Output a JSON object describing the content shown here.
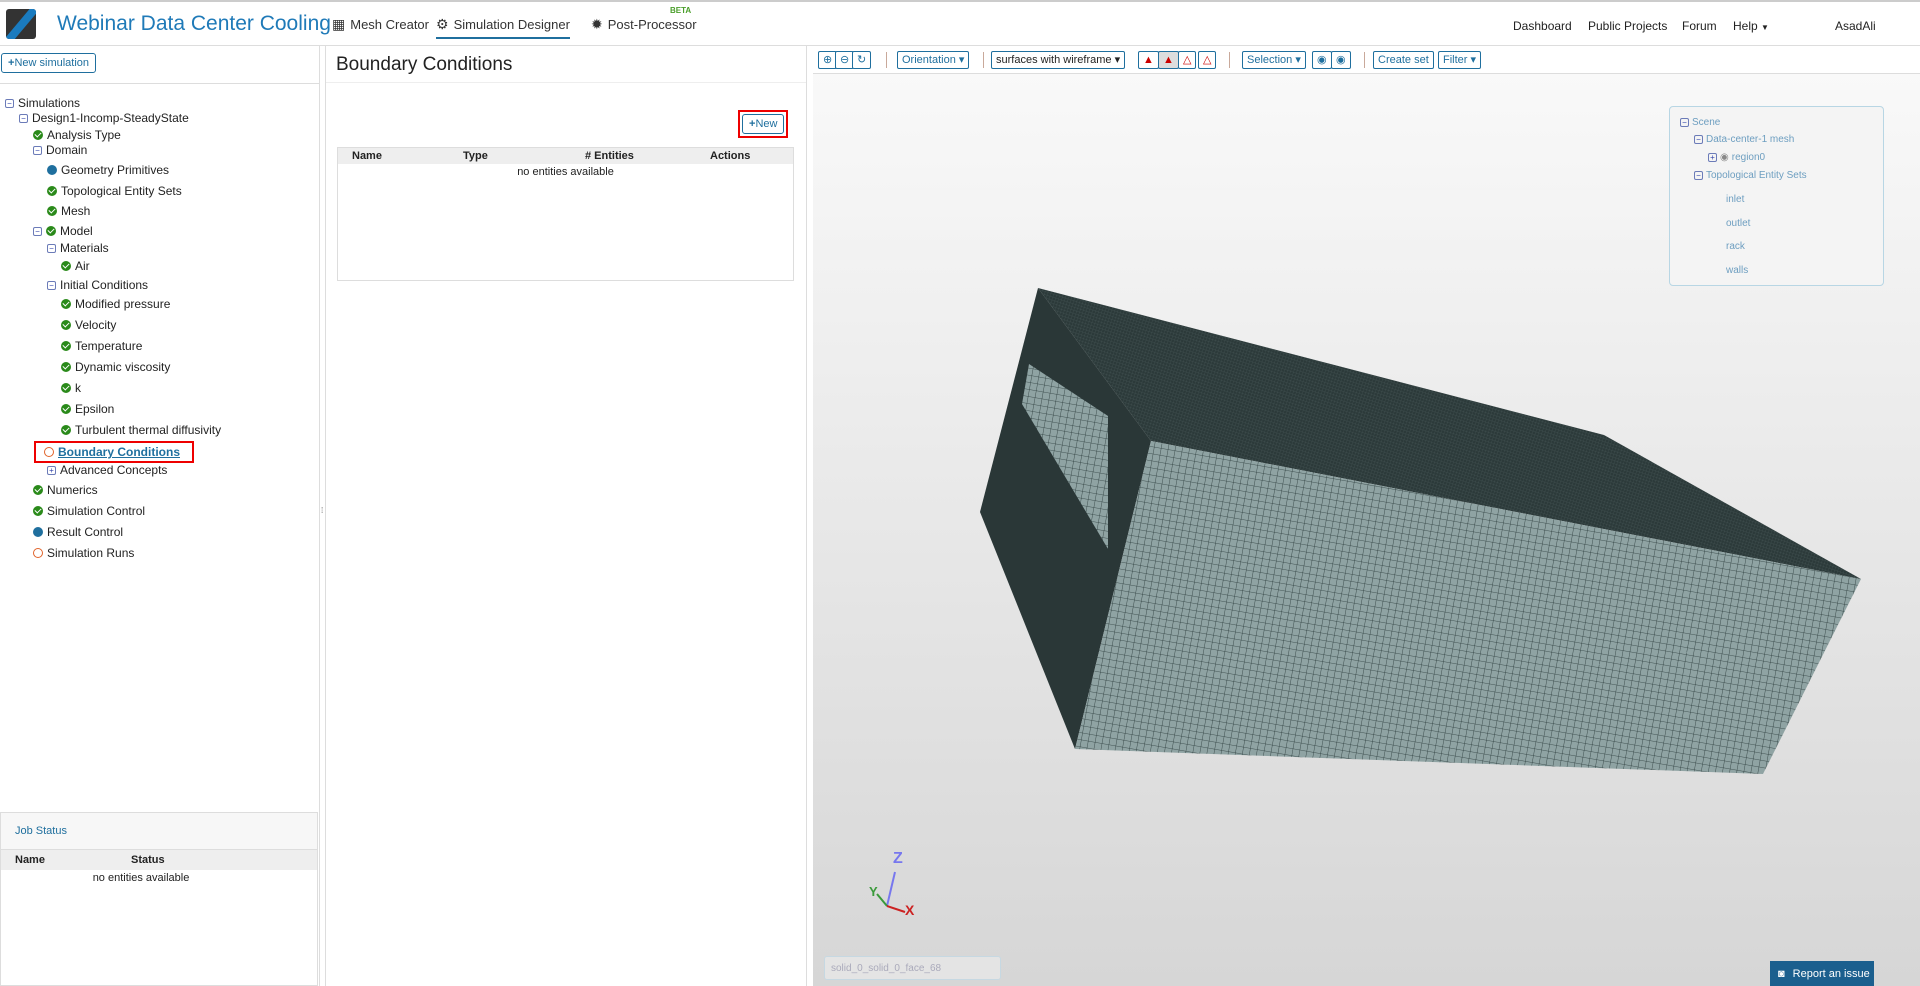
{
  "header": {
    "title": "Webinar Data Center Cooling",
    "nav": [
      "Mesh Creator",
      "Simulation Designer",
      "Post-Processor"
    ],
    "beta": "BETA",
    "right": [
      "Dashboard",
      "Public Projects",
      "Forum",
      "Help",
      "AsadAli"
    ]
  },
  "left": {
    "new_simulation": "New simulation",
    "tree": [
      {
        "label": "Simulations",
        "icon": "minus",
        "level": 0
      },
      {
        "label": "Design1-Incomp-SteadyState",
        "icon": "minus",
        "level": 1
      },
      {
        "label": "Analysis Type",
        "icon": "ok",
        "level": 2
      },
      {
        "label": "Domain",
        "icon": "minus",
        "level": 2
      },
      {
        "label": "Geometry Primitives",
        "icon": "dot",
        "level": 3
      },
      {
        "label": "Topological Entity Sets",
        "icon": "ok",
        "level": 3
      },
      {
        "label": "Mesh",
        "icon": "ok",
        "level": 3
      },
      {
        "label": "Model",
        "icon": "minus-ok",
        "level": 2
      },
      {
        "label": "Materials",
        "icon": "minus",
        "level": 3
      },
      {
        "label": "Air",
        "icon": "ok",
        "level": 4
      },
      {
        "label": "Initial Conditions",
        "icon": "minus",
        "level": 3
      },
      {
        "label": "Modified pressure",
        "icon": "ok",
        "level": 4
      },
      {
        "label": "Velocity",
        "icon": "ok",
        "level": 4
      },
      {
        "label": "Temperature",
        "icon": "ok",
        "level": 4
      },
      {
        "label": "Dynamic viscosity",
        "icon": "ok",
        "level": 4
      },
      {
        "label": "k",
        "icon": "ok",
        "level": 4
      },
      {
        "label": "Epsilon",
        "icon": "ok",
        "level": 4
      },
      {
        "label": "Turbulent thermal diffusivity",
        "icon": "ok",
        "level": 4
      },
      {
        "label": "Boundary Conditions",
        "icon": "ring",
        "level": 3,
        "selected": true
      },
      {
        "label": "Advanced Concepts",
        "icon": "plus",
        "level": 3
      },
      {
        "label": "Numerics",
        "icon": "ok",
        "level": 2
      },
      {
        "label": "Simulation Control",
        "icon": "ok",
        "level": 2
      },
      {
        "label": "Result Control",
        "icon": "dot",
        "level": 2
      },
      {
        "label": "Simulation Runs",
        "icon": "ring",
        "level": 2
      }
    ],
    "job_status": {
      "title": "Job Status",
      "columns": [
        "Name",
        "Status"
      ],
      "empty": "no entities available"
    }
  },
  "middle": {
    "title": "Boundary Conditions",
    "new": "New",
    "columns": [
      "Name",
      "Type",
      "# Entities",
      "Actions"
    ],
    "empty": "no entities available"
  },
  "viewer": {
    "toolbar": {
      "orientation": "Orientation",
      "render_mode": "surfaces with wireframe",
      "selection": "Selection",
      "create_set": "Create set",
      "filter": "Filter"
    },
    "scene": {
      "root": "Scene",
      "mesh": "Data-center-1 mesh",
      "region": "region0",
      "sets_label": "Topological Entity Sets",
      "sets": [
        "inlet",
        "outlet",
        "rack",
        "walls"
      ]
    },
    "axes": {
      "x": "X",
      "y": "Y",
      "z": "Z"
    },
    "selection_field": "solid_0_solid_0_face_68",
    "report": "Report an issue"
  }
}
